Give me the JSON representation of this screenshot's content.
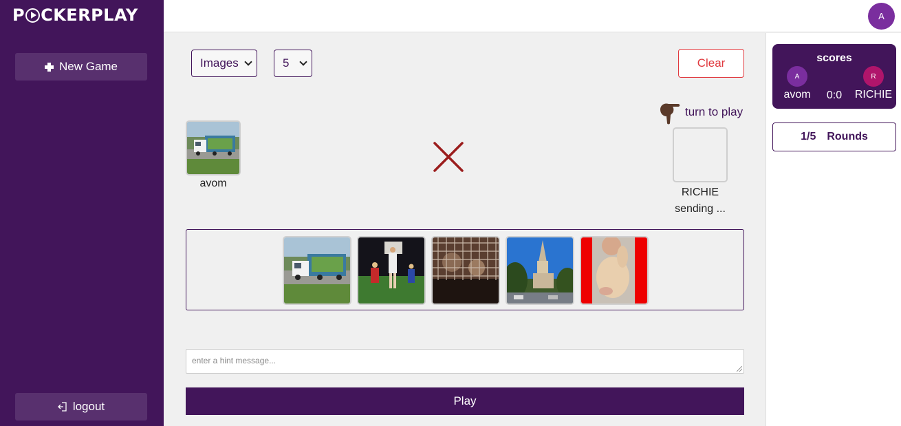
{
  "app": {
    "logo_prefix": "P",
    "logo_suffix": "CKERPLAY"
  },
  "sidebar": {
    "new_game_label": "New Game",
    "logout_label": "logout"
  },
  "topbar": {
    "avatar_initial": "A"
  },
  "controls": {
    "type_select_value": "Images",
    "count_select_value": "5",
    "clear_label": "Clear"
  },
  "board": {
    "player1": {
      "name": "avom"
    },
    "player2": {
      "name": "RICHIE",
      "status": "sending ..."
    },
    "turn_text": "turn to play"
  },
  "tray": {
    "items": [
      {
        "subject": "truck on highway"
      },
      {
        "subject": "people on sports field at night"
      },
      {
        "subject": "animals in cage"
      },
      {
        "subject": "church tower"
      },
      {
        "subject": "person with kitten"
      }
    ]
  },
  "hint": {
    "placeholder": "enter a hint message..."
  },
  "play_label": "Play",
  "scores": {
    "title": "scores",
    "player1": {
      "initial": "A",
      "name": "avom"
    },
    "player2": {
      "initial": "R",
      "name": "RICHIE"
    },
    "value": "0:0"
  },
  "rounds": {
    "progress": "1/5",
    "label": "Rounds"
  },
  "colors": {
    "primary": "#42155a",
    "danger": "#e0393e",
    "accent_avatar": "#7a2e9e",
    "avatar_r": "#b0156b"
  }
}
